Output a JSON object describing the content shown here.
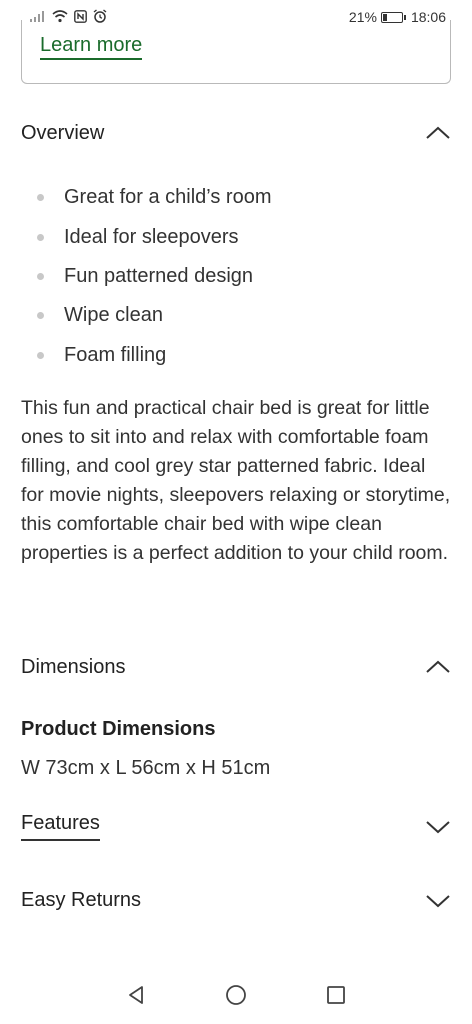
{
  "status_bar": {
    "battery_percent": "21%",
    "battery_level": 0.21,
    "time": "18:06",
    "icons": [
      "signal-icon",
      "wifi-icon",
      "nfc-icon",
      "alarm-icon",
      "battery-icon"
    ]
  },
  "learn_more": {
    "label": "Learn more"
  },
  "overview": {
    "title": "Overview",
    "expanded": true,
    "bullets": [
      "Great for a child’s room",
      "Ideal for sleepovers",
      "Fun patterned design",
      "Wipe clean",
      "Foam filling"
    ],
    "description": "This fun and practical chair bed is great for little ones to sit into and relax with comfortable foam filling, and cool grey star patterned fabric. Ideal for movie nights, sleepovers relaxing or storytime, this comfortable chair bed with wipe clean properties is a perfect addition to your child room."
  },
  "dimensions": {
    "title": "Dimensions",
    "expanded": true,
    "product_title": "Product Dimensions",
    "value": "W 73cm x L 56cm x H 51cm"
  },
  "features": {
    "title": "Features",
    "expanded": false
  },
  "easy_returns": {
    "title": "Easy Returns",
    "expanded": false
  },
  "nav": {
    "icons": [
      "back-icon",
      "home-icon",
      "recents-icon"
    ]
  },
  "colors": {
    "link_green": "#1a6b2b",
    "text": "#222222",
    "bullet": "#c8c8c8"
  }
}
